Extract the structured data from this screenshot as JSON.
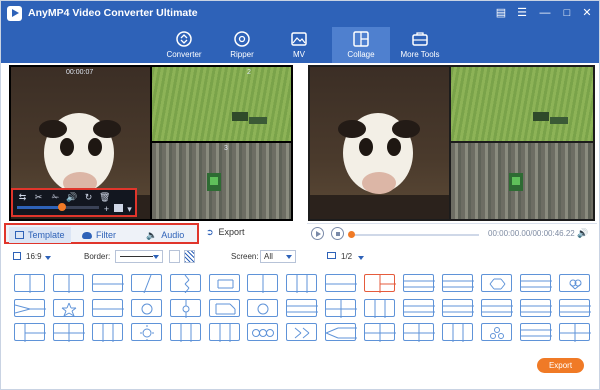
{
  "app": {
    "title": "AnyMP4 Video Converter Ultimate"
  },
  "nav": {
    "items": [
      {
        "label": "Converter",
        "icon": "converter-icon"
      },
      {
        "label": "Ripper",
        "icon": "ripper-icon"
      },
      {
        "label": "MV",
        "icon": "mv-icon"
      },
      {
        "label": "Collage",
        "icon": "collage-icon",
        "active": true
      },
      {
        "label": "More Tools",
        "icon": "toolbox-icon"
      }
    ]
  },
  "preview": {
    "left_time": "00:00:07",
    "cell_numbers": [
      "2",
      "3"
    ],
    "volume_level": 0.55
  },
  "tabs": {
    "template": "Template",
    "filter": "Filter",
    "audio": "Audio",
    "export": "Export"
  },
  "player": {
    "time": "00:00:00.00/00:00:46.22",
    "progress": 0.0
  },
  "options": {
    "ratio": "16:9",
    "border_label": "Border:",
    "screen_label": "Screen:",
    "screen_value": "All",
    "page": "1/2"
  },
  "export_button": "Export",
  "colors": {
    "brand_blue": "#2e62b8",
    "accent_orange": "#f07a26",
    "highlight_red": "#e0352b"
  }
}
